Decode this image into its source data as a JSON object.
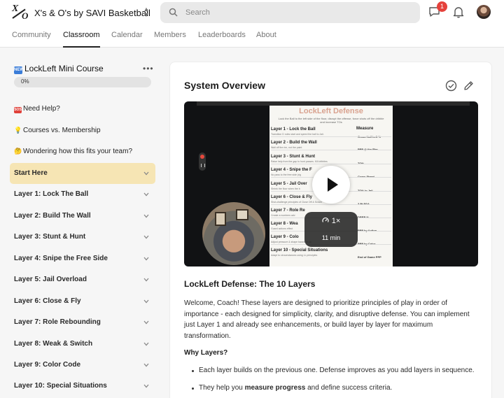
{
  "header": {
    "logo_text": "X's & O's",
    "group_name": "X's & O's by SAVI Basketball",
    "search_placeholder": "Search",
    "notification_count": "1"
  },
  "nav": {
    "tabs": [
      "Community",
      "Classroom",
      "Calendar",
      "Members",
      "Leaderboards",
      "About"
    ],
    "active": "Classroom"
  },
  "sidebar": {
    "course_title": "LockLeft Mini Course",
    "course_badge": "NEW",
    "progress_label": "0%",
    "progress_value": 0,
    "links": [
      {
        "badge": "SOS",
        "label": "Need Help?"
      },
      {
        "icon": "lightbulb-icon",
        "label": "Courses vs. Membership"
      },
      {
        "icon": "thinking-face-icon",
        "label": "Wondering how this fits your team?"
      }
    ],
    "sections": [
      {
        "label": "Start Here"
      },
      {
        "label": "Layer 1: Lock The Ball"
      },
      {
        "label": "Layer 2: Build The Wall"
      },
      {
        "label": "Layer 3: Stunt & Hunt"
      },
      {
        "label": "Layer 4: Snipe the Free Side"
      },
      {
        "label": "Layer 5: Jail Overload"
      },
      {
        "label": "Layer 6: Close & Fly"
      },
      {
        "label": "Layer 7: Role Rebounding"
      },
      {
        "label": "Layer 8: Weak & Switch"
      },
      {
        "label": "Layer 9: Color Code"
      },
      {
        "label": "Layer 10: Special Situations"
      }
    ],
    "active_section": "Start Here"
  },
  "lesson": {
    "title": "System Overview",
    "video": {
      "speed": "1×",
      "duration": "11 min",
      "slide": {
        "title": "LockLeft Defense",
        "subtitle": "Lock the Ball to the left side of the floor, disrupt the offense, force shots off the dribble and increase TOs",
        "measure_header": "Measure",
        "layers": [
          {
            "title": "Layer 1 - Lock the Ball",
            "desc": "Transition D rules start and speed the ball to Jail.",
            "measure": "Cross Half Left %"
          },
          {
            "title": "Layer 2 - Build the Wall",
            "desc": "Wall off the rim, not the paint",
            "measure": "PPP @ the Rim"
          },
          {
            "title": "Layer 3 - Stunt & Hunt",
            "desc": "Raise help from the gap to hunt passes. Kill dribbles",
            "measure": "TO%"
          },
          {
            "title": "Layer 4 - Snipe the F",
            "desc": "No pass to the free side (rig",
            "measure": "Cross Street"
          },
          {
            "title": "Layer 5 - Jail Over",
            "desc": "Shrink the floor when the b",
            "measure": "TO% in Jail"
          },
          {
            "title": "Layer 6 - Close & Fly",
            "desc": "Shot-challenge principles of Close Off & Scram",
            "measure": "3 Pt FGA"
          },
          {
            "title": "Layer 7 - Role Re",
            "desc": "Create a numbers adv",
            "measure": "DREB %"
          },
          {
            "title": "Layer 8 - Wea",
            "desc": "Guard actions effect",
            "measure": "PPP by Action"
          },
          {
            "title": "Layer 9 - Colo",
            "desc": "Adjust pressure & shape based on sc",
            "measure": "PPP by Color"
          },
          {
            "title": "Layer 10 - Special Situations",
            "desc": "Adapt to circumstances using LL principles",
            "measure": "End of Game PPP"
          }
        ]
      }
    },
    "heading": "LockLeft Defense: The 10 Layers",
    "paragraph": "Welcome, Coach! These layers are designed to prioritize principles of play in order of importance - each designed for simplicity, clarity, and disruptive defense. You can implement just Layer 1 and already see enhancements, or build layer by layer for maximum transformation.",
    "subheading": "Why Layers?",
    "bullets": [
      {
        "text": "Each layer builds on the previous one. Defense improves as you add layers in sequence."
      },
      {
        "pre": "They help you ",
        "bold": "measure progress",
        "post": " and define success criteria."
      }
    ]
  }
}
